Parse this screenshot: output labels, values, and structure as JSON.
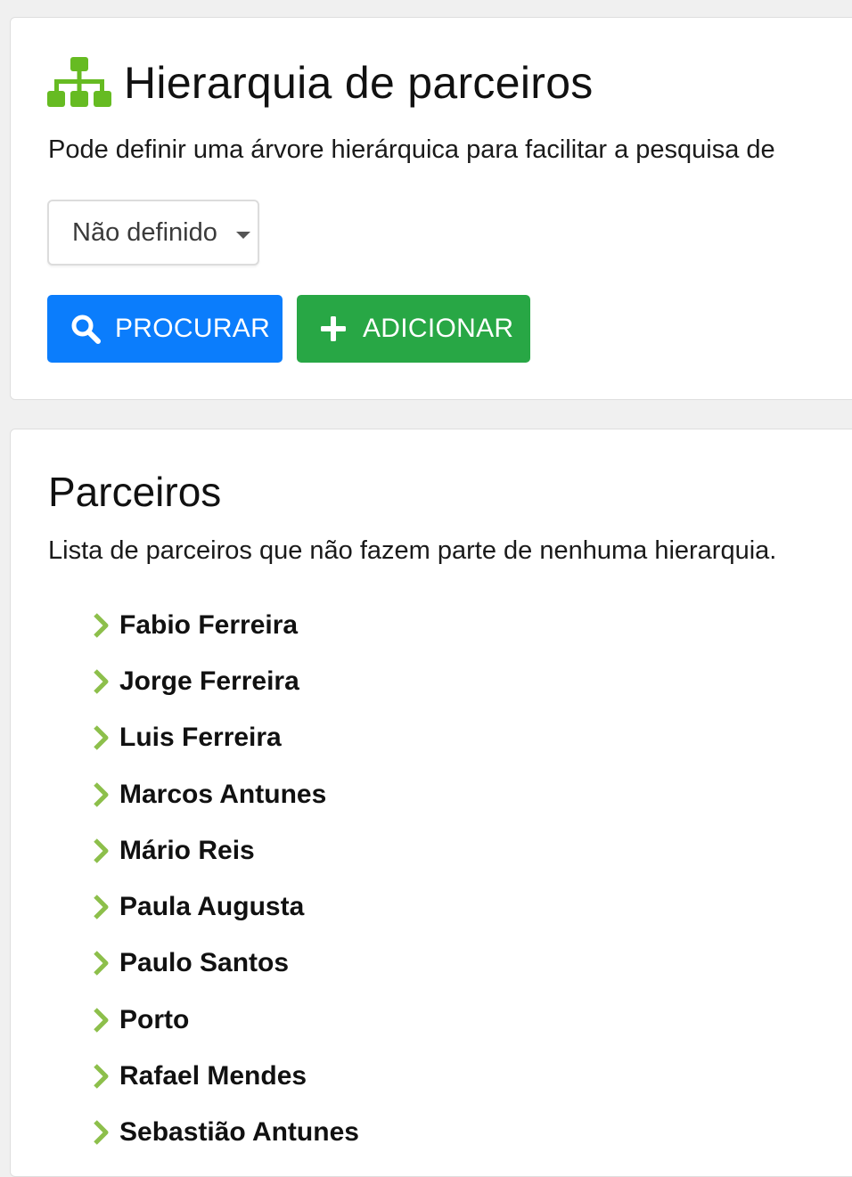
{
  "header": {
    "icon": "sitemap-icon",
    "title": "Hierarquia de parceiros",
    "description": "Pode definir uma árvore hierárquica para facilitar a pesquisa de"
  },
  "filter": {
    "selected_value": "Não definido"
  },
  "actions": {
    "search_label": "PROCURAR",
    "add_label": "ADICIONAR"
  },
  "partners": {
    "title": "Parceiros",
    "description": "Lista de parceiros que não fazem parte de nenhuma hierarquia.",
    "items": [
      {
        "label": "Fabio Ferreira"
      },
      {
        "label": "Jorge Ferreira"
      },
      {
        "label": "Luis Ferreira"
      },
      {
        "label": "Marcos Antunes"
      },
      {
        "label": "Mário Reis"
      },
      {
        "label": "Paula Augusta"
      },
      {
        "label": "Paulo Santos"
      },
      {
        "label": "Porto"
      },
      {
        "label": "Rafael Mendes"
      },
      {
        "label": "Sebastião Antunes"
      }
    ]
  },
  "colors": {
    "accent_green": "#66bb22",
    "chevron_green": "#8dbf4b",
    "primary_blue": "#0b7dfc",
    "success_green": "#28a745"
  }
}
